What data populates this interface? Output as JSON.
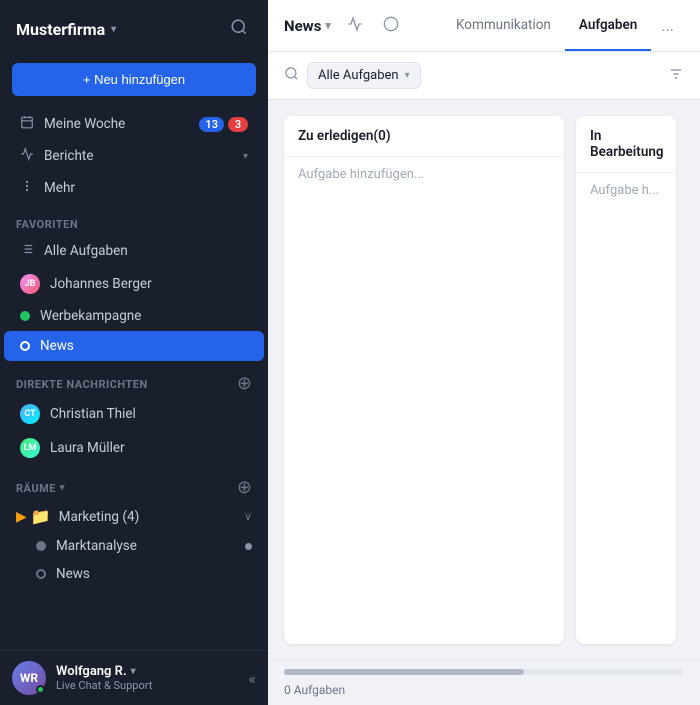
{
  "sidebar": {
    "company": "Musterfirma",
    "add_button": "+ Neu hinzufügen",
    "meine_woche": "Meine Woche",
    "badge_blue": "13",
    "badge_red": "3",
    "berichte": "Berichte",
    "mehr": "Mehr",
    "favoriten_label": "Favoriten",
    "alle_aufgaben": "Alle Aufgaben",
    "johannes_berger": "Johannes Berger",
    "werbekampagne": "Werbekampagne",
    "news": "News",
    "direkte_nachrichten": "Direkte Nachrichten",
    "christian_thiel": "Christian Thiel",
    "laura_mueller": "Laura Müller",
    "raume": "Räume",
    "marketing": "Marketing (4)",
    "marktanalyse": "Marktanalyse",
    "news_sub": "News",
    "user_name": "Wolfgang R.",
    "user_status": "Live Chat & Support"
  },
  "topbar": {
    "channel_name": "News",
    "tab_kommunikation": "Kommunikation",
    "tab_aufgaben": "Aufgaben",
    "tab_more": "..."
  },
  "filter": {
    "search_icon": "🔍",
    "filter_label": "Alle Aufgaben",
    "filter_icon": "≡"
  },
  "kanban": {
    "col1_title": "Zu erledigen(0)",
    "col1_add": "Aufgabe hinzufügen...",
    "col2_title": "In Bearbeitung",
    "col2_add": "Aufgabe h..."
  },
  "footer": {
    "count_label": "0 Aufgaben"
  }
}
